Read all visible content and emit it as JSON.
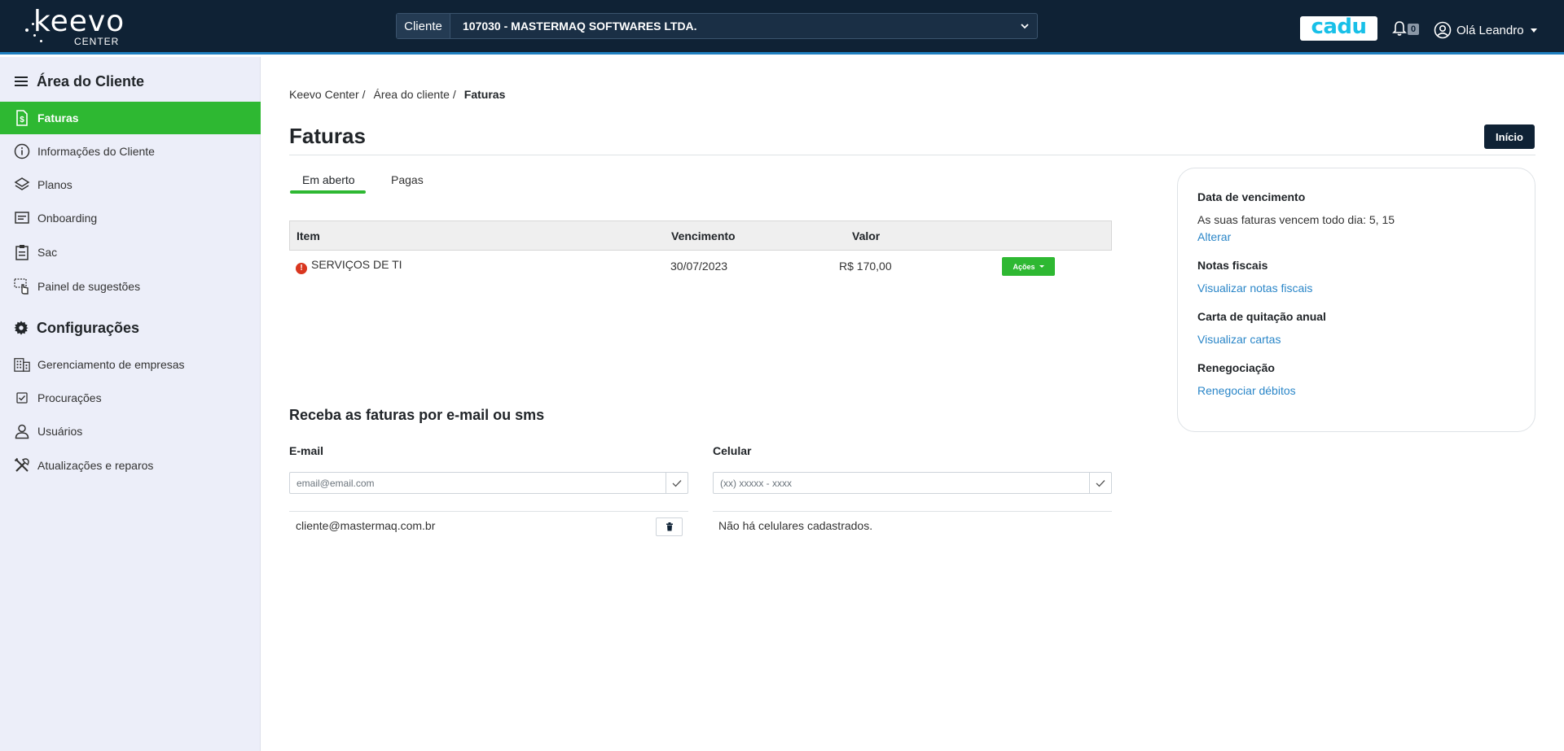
{
  "header": {
    "logo_text": "keevo",
    "logo_sub": "CENTER",
    "client_label": "Cliente",
    "client_value": "107030 - MASTERMAQ SOFTWARES LTDA.",
    "cadu_label": "cadu",
    "notifications_count": "0",
    "user_greeting": "Olá Leandro"
  },
  "sidebar": {
    "section1_title": "Área do Cliente",
    "items1": [
      {
        "label": "Faturas",
        "icon": "invoice-icon",
        "active": true
      },
      {
        "label": "Informações do Cliente",
        "icon": "info-icon"
      },
      {
        "label": "Planos",
        "icon": "layers-icon"
      },
      {
        "label": "Onboarding",
        "icon": "onboarding-icon"
      },
      {
        "label": "Sac",
        "icon": "clipboard-icon"
      },
      {
        "label": "Painel de sugestões",
        "icon": "suggestion-icon"
      }
    ],
    "section2_title": "Configurações",
    "items2": [
      {
        "label": "Gerenciamento de empresas",
        "icon": "building-icon"
      },
      {
        "label": "Procurações",
        "icon": "checkbox-icon"
      },
      {
        "label": "Usuários",
        "icon": "user-icon"
      },
      {
        "label": "Atualizações e reparos",
        "icon": "tools-icon"
      }
    ]
  },
  "breadcrumb": {
    "items": [
      "Keevo Center",
      "Área do cliente"
    ],
    "separator": "/",
    "current": "Faturas"
  },
  "page": {
    "title": "Faturas",
    "inicio_button": "Início"
  },
  "tabs": [
    {
      "label": "Em aberto",
      "active": true
    },
    {
      "label": "Pagas",
      "active": false
    }
  ],
  "table": {
    "headers": [
      "Item",
      "Vencimento",
      "Valor"
    ],
    "rows": [
      {
        "item": "SERVIÇOS DE TI",
        "vencimento": "30/07/2023",
        "valor": "R$ 170,00",
        "action": "Ações"
      }
    ]
  },
  "notifications_section": {
    "title": "Receba as faturas por e-mail ou sms",
    "email_label": "E-mail",
    "email_placeholder": "email@email.com",
    "email_list": [
      "cliente@mastermaq.com.br"
    ],
    "phone_label": "Celular",
    "phone_placeholder": "(xx) xxxxx - xxxx",
    "phone_empty": "Não há celulares cadastrados."
  },
  "side_card": {
    "due_title": "Data de vencimento",
    "due_text": "As suas faturas vencem todo dia: 5, 15",
    "due_link": "Alterar",
    "nf_title": "Notas fiscais",
    "nf_link": "Visualizar notas fiscais",
    "carta_title": "Carta de quitação anual",
    "carta_link": "Visualizar cartas",
    "reneg_title": "Renegociação",
    "reneg_link": "Renegociar débitos"
  },
  "colors": {
    "header_bg": "#0f2235",
    "sidebar_bg": "#eceef9",
    "accent_green": "#2eb832",
    "link_blue": "#2a86c8"
  }
}
